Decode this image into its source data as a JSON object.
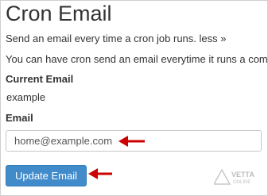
{
  "page": {
    "title": "Cron Email",
    "description": "Send an email every time a cron job runs.",
    "less_link": "less »",
    "details": "You can have cron send an email everytime it runs a command. If you do not want an email to be sent for an individual cron job you can redirect the command’s output to /dev/null."
  },
  "current": {
    "label": "Current Email",
    "value": "example"
  },
  "email": {
    "label": "Email",
    "value": "home@example.com"
  },
  "button": {
    "label": "Update Email"
  },
  "watermark": {
    "line1": "VETTA",
    "line2": "ONLINE"
  },
  "colors": {
    "accent": "#428bca",
    "arrow": "#cc0000"
  }
}
